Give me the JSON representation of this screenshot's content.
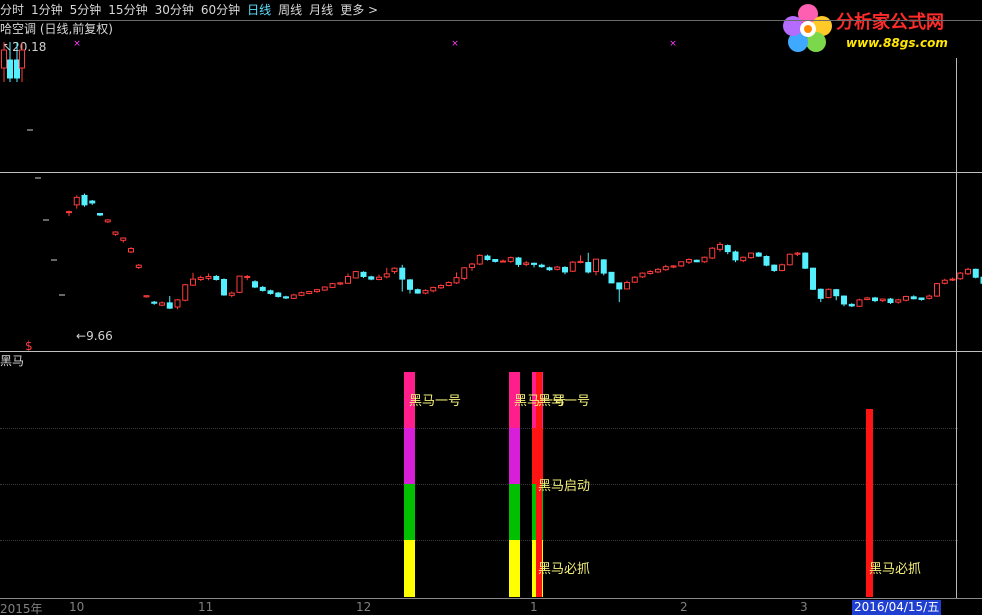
{
  "toolbar": {
    "timeframes": [
      {
        "label": "分时",
        "active": false
      },
      {
        "label": "1分钟",
        "active": false
      },
      {
        "label": "5分钟",
        "active": false
      },
      {
        "label": "15分钟",
        "active": false
      },
      {
        "label": "30分钟",
        "active": false
      },
      {
        "label": "60分钟",
        "active": false
      },
      {
        "label": "日线",
        "active": true
      },
      {
        "label": "周线",
        "active": false
      },
      {
        "label": "月线",
        "active": false
      },
      {
        "label": "更多 >",
        "active": false
      }
    ]
  },
  "logo": {
    "text": "分析家公式网",
    "url": "www.88gs.com"
  },
  "main_chart": {
    "title": "哈空调 (日线,前复权)",
    "high_label": "20.18",
    "low_label": "9.66",
    "dollar_marker": "$",
    "colors": {
      "up": "#ff3c3c",
      "down": "#54f0ff",
      "marker": "#ff40ff"
    }
  },
  "indicator": {
    "name": "黑马",
    "signal_labels": [
      "黑马一号",
      "黑马一号",
      "黑马启动",
      "黑马必抓",
      "黑马必抓"
    ],
    "colors": {
      "pink": "#ff1e8c",
      "magenta": "#d81ed8",
      "green": "#00c000",
      "yellow": "#ffff00",
      "red": "#ff1414",
      "label": "#f5f07a"
    }
  },
  "x_axis": {
    "labels": [
      "2015年",
      "10",
      "11",
      "12",
      "1",
      "2",
      "3"
    ],
    "cursor_date": "2016/04/15/五"
  },
  "chart_data": {
    "type": "candlestick",
    "x_unit": "trading day index (2015-09 to 2016-04)",
    "y_range": [
      9.66,
      20.18
    ],
    "candles": [
      [
        62,
        62.2,
        61,
        62.5
      ],
      [
        64,
        66,
        63,
        66.5
      ],
      [
        66.5,
        64,
        63.5,
        67
      ],
      [
        65,
        64.5,
        64,
        65.3
      ],
      [
        61.7,
        61.3,
        61,
        61.8
      ],
      [
        59.5,
        60,
        59.2,
        60.2
      ],
      [
        56.2,
        56.8,
        55.8,
        57
      ],
      [
        54.6,
        55.2,
        54,
        55.4
      ],
      [
        51.5,
        52.4,
        51.2,
        52.8
      ],
      [
        47.4,
        48,
        47,
        48.3
      ],
      [
        39.6,
        39.9,
        39.4,
        40
      ],
      [
        38.2,
        37.9,
        37.5,
        38.5
      ],
      [
        37.4,
        38,
        37.1,
        38.4
      ],
      [
        38,
        36.6,
        36.4,
        39.8
      ],
      [
        36.9,
        38.8,
        36.3,
        39
      ],
      [
        38.7,
        42.8,
        38.4,
        43
      ],
      [
        42.7,
        44.3,
        42.5,
        46
      ],
      [
        44.2,
        44.7,
        43.8,
        45.2
      ],
      [
        44.5,
        45,
        44,
        45.8
      ],
      [
        45,
        44.2,
        43.9,
        45.4
      ],
      [
        44.2,
        40.1,
        39.9,
        44.5
      ],
      [
        40,
        40.6,
        39.5,
        41
      ],
      [
        40.8,
        45.1,
        40.6,
        45.2
      ],
      [
        44.9,
        45,
        44,
        45.4
      ],
      [
        43.6,
        42.2,
        41.9,
        44
      ],
      [
        42.1,
        41.3,
        41,
        42.5
      ],
      [
        41.2,
        40.5,
        40.2,
        41.5
      ],
      [
        40.6,
        39.7,
        39.4,
        40.9
      ],
      [
        39.6,
        39.3,
        39,
        39.9
      ],
      [
        39.2,
        40.1,
        39,
        40.4
      ],
      [
        40,
        40.7,
        39.8,
        41
      ],
      [
        40.5,
        41,
        40.3,
        41.2
      ],
      [
        41,
        41.5,
        40.7,
        41.7
      ],
      [
        41.4,
        42.2,
        41.2,
        42.4
      ],
      [
        42.1,
        43.1,
        41.9,
        43.3
      ],
      [
        43,
        43.3,
        42.7,
        43.5
      ],
      [
        43.2,
        45,
        43,
        45.8
      ],
      [
        44.6,
        46.3,
        44.5,
        46.5
      ],
      [
        46.1,
        45,
        44.6,
        46.4
      ],
      [
        44.9,
        44.3,
        44,
        45.2
      ],
      [
        44.2,
        44.8,
        44,
        45.5
      ],
      [
        44.9,
        45.7,
        44.5,
        47.3
      ],
      [
        46.3,
        47.2,
        45.7,
        47.4
      ],
      [
        47.2,
        44.3,
        41,
        48.1
      ],
      [
        44.1,
        41.6,
        40.5,
        44.3
      ],
      [
        41.5,
        40.6,
        40.4,
        41.8
      ],
      [
        40.6,
        41.3,
        40.3,
        41.6
      ],
      [
        41.2,
        42.1,
        40.8,
        42.3
      ],
      [
        42,
        42.6,
        41.7,
        42.9
      ],
      [
        42.6,
        43.4,
        42.4,
        43.7
      ],
      [
        43.3,
        44.7,
        43,
        46.1
      ],
      [
        44.5,
        47.3,
        44,
        47.5
      ],
      [
        47.4,
        48.3,
        46.5,
        48.6
      ],
      [
        48.3,
        50.6,
        48,
        50.9
      ],
      [
        50.4,
        49.5,
        49.2,
        50.8
      ],
      [
        49.5,
        49,
        48.7,
        49.6
      ],
      [
        49.1,
        49.1,
        48.8,
        49.5
      ],
      [
        49,
        50,
        48.6,
        50.3
      ],
      [
        49.9,
        48.2,
        47.5,
        50.2
      ],
      [
        48.2,
        48.6,
        47.7,
        49.1
      ],
      [
        48.5,
        48.2,
        47.4,
        48.7
      ],
      [
        48,
        47.6,
        47.3,
        48.4
      ],
      [
        47.3,
        46.8,
        46.5,
        47.6
      ],
      [
        46.9,
        47.5,
        46.6,
        47.8
      ],
      [
        47.4,
        46.2,
        45.6,
        47.7
      ],
      [
        46.4,
        48.8,
        46.2,
        49.1
      ],
      [
        48.7,
        49,
        48.5,
        50.6
      ],
      [
        48.7,
        46.2,
        45.8,
        51.3
      ],
      [
        46.3,
        49.6,
        45.3,
        49.7
      ],
      [
        49.4,
        45.9,
        45.3,
        49.6
      ],
      [
        46.1,
        43.3,
        43.2,
        46.2
      ],
      [
        43.3,
        41.7,
        38.2,
        43.4
      ],
      [
        41.7,
        43.4,
        41.6,
        43.9
      ],
      [
        43.5,
        44.8,
        43.3,
        45.1
      ],
      [
        44.9,
        45.9,
        44.6,
        46.1
      ],
      [
        45.8,
        46.3,
        45.5,
        46.7
      ],
      [
        46.2,
        46.9,
        45.9,
        47.2
      ],
      [
        46.8,
        47.6,
        46.5,
        48.1
      ],
      [
        47.5,
        47.8,
        47.2,
        48
      ],
      [
        47.8,
        48.9,
        47.5,
        49
      ],
      [
        48.8,
        49.5,
        48.3,
        49.8
      ],
      [
        49.3,
        48.9,
        48.8,
        49.5
      ],
      [
        48.9,
        50.1,
        48.6,
        50.3
      ],
      [
        49.9,
        52.5,
        49.6,
        52.8
      ],
      [
        52.2,
        53.5,
        51.6,
        54.1
      ],
      [
        53.2,
        51.6,
        50.9,
        53.5
      ],
      [
        51.5,
        49.4,
        48.8,
        51.9
      ],
      [
        49.2,
        50.1,
        48.8,
        50.3
      ],
      [
        50,
        51.2,
        49.7,
        51.3
      ],
      [
        51.2,
        50.4,
        50.2,
        51.5
      ],
      [
        50.3,
        48,
        47.7,
        50.6
      ],
      [
        48,
        46.6,
        46.2,
        48.2
      ],
      [
        46.6,
        48.1,
        46.4,
        48.4
      ],
      [
        48.1,
        50.9,
        47.9,
        51.1
      ],
      [
        50.9,
        51.2,
        50.4,
        51.5
      ],
      [
        51.2,
        47.2,
        47,
        51.4
      ],
      [
        47.2,
        41.6,
        41.4,
        47.3
      ],
      [
        41.6,
        39.2,
        38.2,
        41.8
      ],
      [
        39.4,
        41.6,
        39.2,
        41.8
      ],
      [
        41.5,
        39.9,
        38.7,
        41.7
      ],
      [
        39.8,
        37.7,
        37.1,
        40
      ],
      [
        37.6,
        37.2,
        36.9,
        37.9
      ],
      [
        37.1,
        38.8,
        36.9,
        39.1
      ],
      [
        38.9,
        39.3,
        38.7,
        39.6
      ],
      [
        39.3,
        38.6,
        38.2,
        39.6
      ],
      [
        38.6,
        39,
        38.2,
        39.2
      ],
      [
        39,
        38.1,
        37.7,
        39.3
      ],
      [
        38.2,
        38.8,
        37.8,
        39.1
      ],
      [
        38.7,
        39.7,
        38.4,
        39.9
      ],
      [
        39.6,
        39.1,
        38.9,
        40
      ],
      [
        39.3,
        38.9,
        38.6,
        39.4
      ],
      [
        39.2,
        39.8,
        38.9,
        40.2
      ],
      [
        39.8,
        43.1,
        39.6,
        43.3
      ],
      [
        43.2,
        44,
        42.9,
        44.4
      ],
      [
        44.1,
        44.3,
        43.8,
        44.7
      ],
      [
        44.4,
        45.9,
        44.1,
        46.2
      ],
      [
        45.7,
        46.9,
        45.4,
        47.3
      ],
      [
        46.9,
        44.8,
        44.5,
        47.1
      ],
      [
        44.8,
        43.2,
        42.9,
        45
      ],
      [
        43.1,
        43.8,
        42.6,
        44.1
      ],
      [
        43.8,
        44.5,
        43.5,
        44.8
      ],
      [
        44.4,
        44.2,
        44,
        44.7
      ]
    ],
    "markers_x": [
      77,
      455,
      673
    ],
    "indicator_signals": [
      {
        "candle": 41,
        "type": "黑马一号",
        "segments": [
          "pink",
          "magenta",
          "green",
          "yellow"
        ]
      },
      {
        "candle": 56,
        "type": "黑马一号",
        "segments": [
          "pink",
          "magenta",
          "green",
          "yellow"
        ]
      },
      {
        "candle": 59,
        "type": "黑马启动",
        "segments": [
          "pink",
          "red",
          "green",
          "yellow"
        ]
      },
      {
        "candle": 59,
        "type": "黑马必抓",
        "segments": [
          "red"
        ]
      },
      {
        "candle": 107,
        "type": "黑马必抓",
        "segments": [
          "red"
        ]
      }
    ]
  }
}
